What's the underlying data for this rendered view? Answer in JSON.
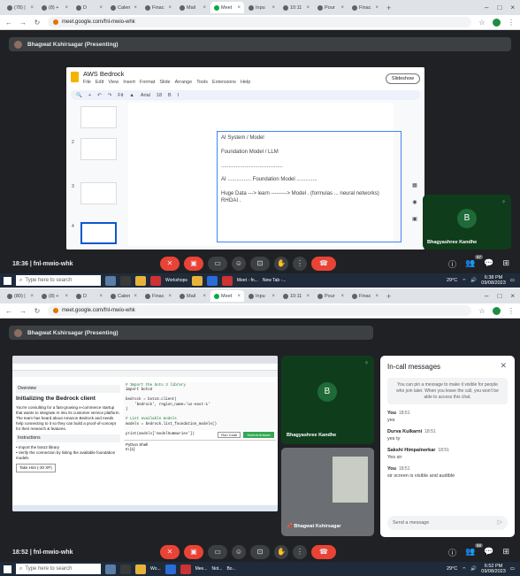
{
  "shot1": {
    "tabs": [
      "(78) |",
      "(8) +",
      "D",
      "Calen",
      "Finac",
      "Mail",
      "Meet",
      "Inpu",
      "10:11",
      "Pour",
      "Finac"
    ],
    "url": "meet.google.com/fnl-mwio-whk",
    "banner": "Bhagwat Kshirsagar (Presenting)",
    "slides": {
      "title": "AWS Bedrock",
      "menu": [
        "File",
        "Edit",
        "View",
        "Insert",
        "Format",
        "Slide",
        "Arrange",
        "Tools",
        "Extensions",
        "Help"
      ],
      "slideshow": "Slideshow",
      "font": "Arial",
      "font_size": "18",
      "toolbar_fit": "Fit",
      "thumb_numbers": [
        "2",
        "3",
        "4"
      ],
      "lines": [
        "AI System / Model",
        "Foundation Model / LLM",
        "..........................................",
        "AI ................ Foundation Model ..............",
        "Huge Data ---> learn ---------> Model . (formulas ... neural networks) RHOAI ."
      ]
    },
    "tile_name": "Bhagyashree Kandhe",
    "tile_letter": "B",
    "meeting_time": "18:36",
    "meeting_code": "fnl-mwio-whk",
    "people_count": "57",
    "taskbar": {
      "search": "Type here to search",
      "apps": [
        "Workshops",
        "Meet - fn...",
        "New Tab -..."
      ],
      "weather": "29°C",
      "time": "6:38 PM",
      "date": "09/08/2023"
    }
  },
  "shot2": {
    "tabs": [
      "(80) |",
      "(8) +",
      "D",
      "Calen",
      "Finac",
      "Mail",
      "Meet",
      "Inpu",
      "10:11",
      "Pour",
      "Finac"
    ],
    "url": "meet.google.com/fnl-mwio-whk",
    "banner": "Bhagwat Kshirsagar (Presenting)",
    "shared": {
      "sidebar_header": "Overview",
      "heading": "Initializing the Bedrock client",
      "body": "You're consulting for a fast-growing e-commerce startup that wants to integrate AI into its customer service platform. The team has heard about Amazon Bedrock and needs help connecting to it so they can build a proof-of-concept for their research & features.",
      "instructions_label": "Instructions",
      "points": [
        "Import the boto3 library",
        "Verify the connection by listing the available foundation models"
      ],
      "hint": "Take Hint (-30 XP)",
      "code_lines": [
        "# Import the boto 3 library",
        "import boto3",
        "",
        "bedrock = boto3.client(",
        "    'bedrock', region_name='us-east-1'",
        ")",
        "",
        "# List available models",
        "models = bedrock.list_foundation_models()",
        "",
        "print(models['modelSummaries'])"
      ],
      "run_label": "Run Code",
      "submit_label": "Submit Answer",
      "shell_label": "Python Shell",
      "prompt": "In [1]:"
    },
    "tiles": [
      {
        "name": "Bhagyashree Kandhe",
        "letter": "B"
      },
      {
        "name": "Bhagwat Kshirsagar"
      }
    ],
    "chat": {
      "title": "In-call messages",
      "notice": "You can pin a message to make it visible for people who join later. When you leave the call, you won't be able to access this chat.",
      "messages": [
        {
          "who": "You",
          "time": "18:51",
          "text": "yes"
        },
        {
          "who": "Durva Kulkarni",
          "time": "18:51",
          "text": "yes ty"
        },
        {
          "who": "Sakshi Himpalnerkar",
          "time": "18:51",
          "text": "Yes sir"
        },
        {
          "who": "You",
          "time": "18:51",
          "text": "sir screen is visible and audible"
        }
      ],
      "input_placeholder": "Send a message"
    },
    "meeting_time": "18:52",
    "meeting_code": "fnl-mwio-whk",
    "people_count": "58",
    "taskbar": {
      "search": "Type here to search",
      "apps": [
        "Wo...",
        "Mee...",
        "Not...",
        "Bo..."
      ],
      "weather": "29°C",
      "time": "6:52 PM",
      "date": "09/08/2023"
    }
  },
  "colors": {
    "meet_bg": "#202124",
    "leave_red": "#ea4335",
    "tile_green": "#0f3d1c",
    "slides_blue": "#4285f4"
  }
}
